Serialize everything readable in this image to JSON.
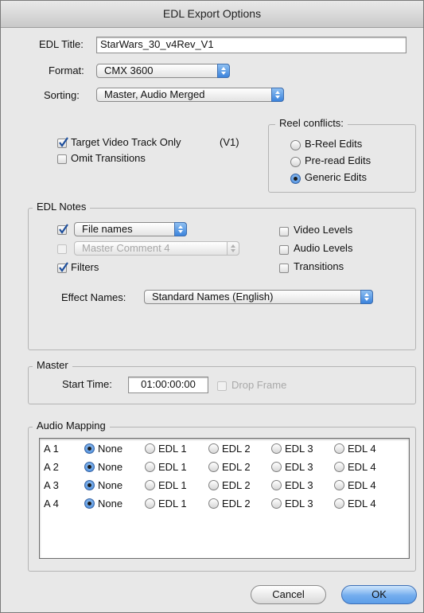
{
  "window": {
    "title": "EDL Export Options"
  },
  "edl_title": {
    "label": "EDL Title:",
    "value": "StarWars_30_v4Rev_V1"
  },
  "format": {
    "label": "Format:",
    "value": "CMX 3600"
  },
  "sorting": {
    "label": "Sorting:",
    "value": "Master, Audio Merged"
  },
  "options": {
    "target_video_track_only": {
      "label": "Target Video Track Only",
      "checked": true,
      "suffix": "(V1)"
    },
    "omit_transitions": {
      "label": "Omit Transitions",
      "checked": false
    }
  },
  "reel_conflicts": {
    "legend": "Reel conflicts:",
    "options": [
      {
        "label": "B-Reel Edits",
        "selected": false
      },
      {
        "label": "Pre-read Edits",
        "selected": false
      },
      {
        "label": "Generic Edits",
        "selected": true
      }
    ]
  },
  "edl_notes": {
    "legend": "EDL Notes",
    "file_names": {
      "checked": true,
      "popup_value": "File names"
    },
    "master_comment": {
      "checked": false,
      "popup_value": "Master Comment 4",
      "enabled": false
    },
    "filters": {
      "label": "Filters",
      "checked": true
    },
    "video_levels": {
      "label": "Video Levels",
      "checked": false
    },
    "audio_levels": {
      "label": "Audio Levels",
      "checked": false
    },
    "transitions": {
      "label": "Transitions",
      "checked": false
    },
    "effect_names": {
      "label": "Effect Names:",
      "value": "Standard Names (English)"
    }
  },
  "master": {
    "legend": "Master",
    "start_time_label": "Start Time:",
    "start_time": "01:00:00:00",
    "drop_frame": {
      "label": "Drop Frame",
      "checked": false,
      "enabled": false
    }
  },
  "audio_mapping": {
    "legend": "Audio Mapping",
    "columns": [
      "None",
      "EDL 1",
      "EDL 2",
      "EDL 3",
      "EDL 4"
    ],
    "rows": [
      {
        "track": "A 1",
        "selected": "None"
      },
      {
        "track": "A 2",
        "selected": "None"
      },
      {
        "track": "A 3",
        "selected": "None"
      },
      {
        "track": "A 4",
        "selected": "None"
      }
    ]
  },
  "buttons": {
    "cancel": "Cancel",
    "ok": "OK"
  },
  "colors": {
    "accent": "#5c9ee8",
    "window_bg": "#e8e8e8"
  }
}
